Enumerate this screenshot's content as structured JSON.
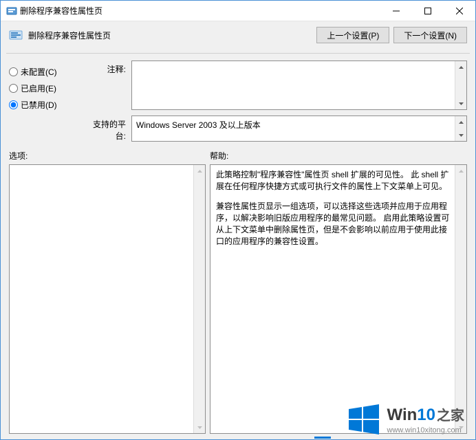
{
  "title": "删除程序兼容性属性页",
  "header": {
    "subtitle": "删除程序兼容性属性页",
    "prev_btn": "上一个设置(P)",
    "next_btn": "下一个设置(N)"
  },
  "radio": {
    "not_configured": "未配置(C)",
    "enabled": "已启用(E)",
    "disabled": "已禁用(D)",
    "selected": "disabled"
  },
  "fields": {
    "comment_label": "注释:",
    "comment_value": "",
    "platform_label": "支持的平台:",
    "platform_value": "Windows Server 2003 及以上版本"
  },
  "lower": {
    "options_label": "选项:",
    "help_label": "帮助:",
    "help_p1": "此策略控制\"程序兼容性\"属性页 shell 扩展的可见性。 此 shell 扩展在任何程序快捷方式或可执行文件的属性上下文菜单上可见。",
    "help_p2": "兼容性属性页显示一组选项，可以选择这些选项并应用于应用程序，以解决影响旧版应用程序的最常见问题。 启用此策略设置可从上下文菜单中删除属性页，但是不会影响以前应用于使用此接口的应用程序的兼容性设置。"
  },
  "watermark": {
    "brand_prefix": "Win",
    "brand_num": "10",
    "brand_suffix": "之家",
    "url": "www.win10xitong.com"
  }
}
